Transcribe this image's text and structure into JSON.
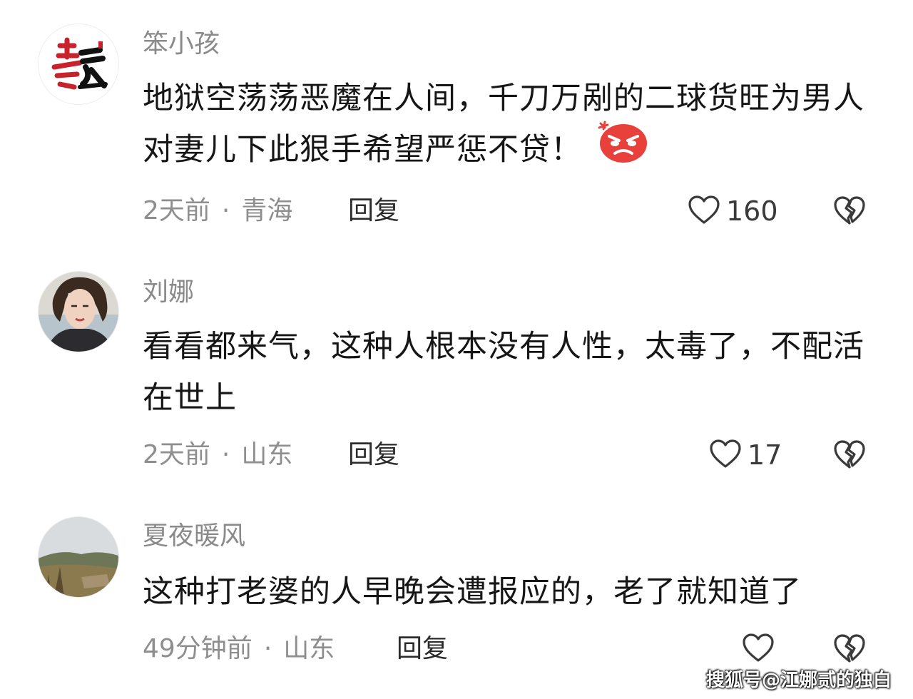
{
  "comments": [
    {
      "username": "笨小孩",
      "avatar_icon": "calligraphy-avatar",
      "text": "地狱空荡荡恶魔在人间，千刀万剐的二球货旺为男人对妻儿下此狠手希望严惩不贷！",
      "emoji_icon": "angry-face-emoji",
      "time": "2天前",
      "location": "青海",
      "reply_label": "回复",
      "likes": "160"
    },
    {
      "username": "刘娜",
      "avatar_icon": "woman-portrait-avatar",
      "text": "看看都来气，这种人根本没有人性，太毒了，不配活在世上",
      "time": "2天前",
      "location": "山东",
      "reply_label": "回复",
      "likes": "17"
    },
    {
      "username": "夏夜暖风",
      "avatar_icon": "landscape-avatar",
      "text": "这种打老婆的人早晚会遭报应的，老了就知道了",
      "time": "49分钟前",
      "location": "山东",
      "reply_label": "回复",
      "likes": ""
    }
  ],
  "meta_separator": "·",
  "icons": {
    "like": "heart-outline-icon",
    "dislike": "broken-heart-icon"
  },
  "watermark": "搜狐号@江娜贰的独白",
  "colors": {
    "username": "#8a8a8a",
    "meta": "#8e8e8e",
    "text": "#161616",
    "emoji": "#e8403a"
  }
}
